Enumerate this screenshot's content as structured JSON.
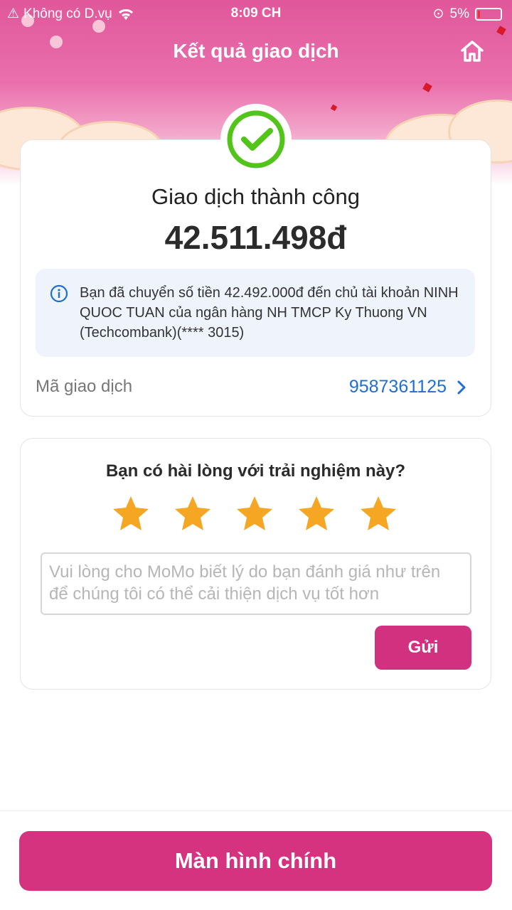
{
  "status_bar": {
    "carrier": "Không có D.vụ",
    "time": "8:09 CH",
    "battery": "5%"
  },
  "header": {
    "title": "Kết quả giao dịch",
    "home_icon": "home-icon"
  },
  "result": {
    "status_text": "Giao dịch thành công",
    "amount": "42.511.498đ",
    "info_text": "Bạn đã chuyển số tiền 42.492.000đ đến chủ tài khoản NINH QUOC TUAN của ngân hàng NH TMCP Ky Thuong VN (Techcombank)(**** 3015)",
    "txn_label": "Mã giao dịch",
    "txn_id": "9587361125",
    "success_color": "#52c41a"
  },
  "rating": {
    "question": "Bạn có hài lòng với trải nghiệm này?",
    "stars_selected": 5,
    "stars_total": 5,
    "star_color": "#f5a623",
    "feedback_placeholder": "Vui lòng cho MoMo biết lý do bạn đánh giá như trên để chúng tôi có thể cải thiện dịch vụ tốt hơn",
    "send_label": "Gửi"
  },
  "footer": {
    "main_button": "Màn hình chính"
  },
  "colors": {
    "brand": "#d5337f",
    "link": "#1f6fd1"
  }
}
